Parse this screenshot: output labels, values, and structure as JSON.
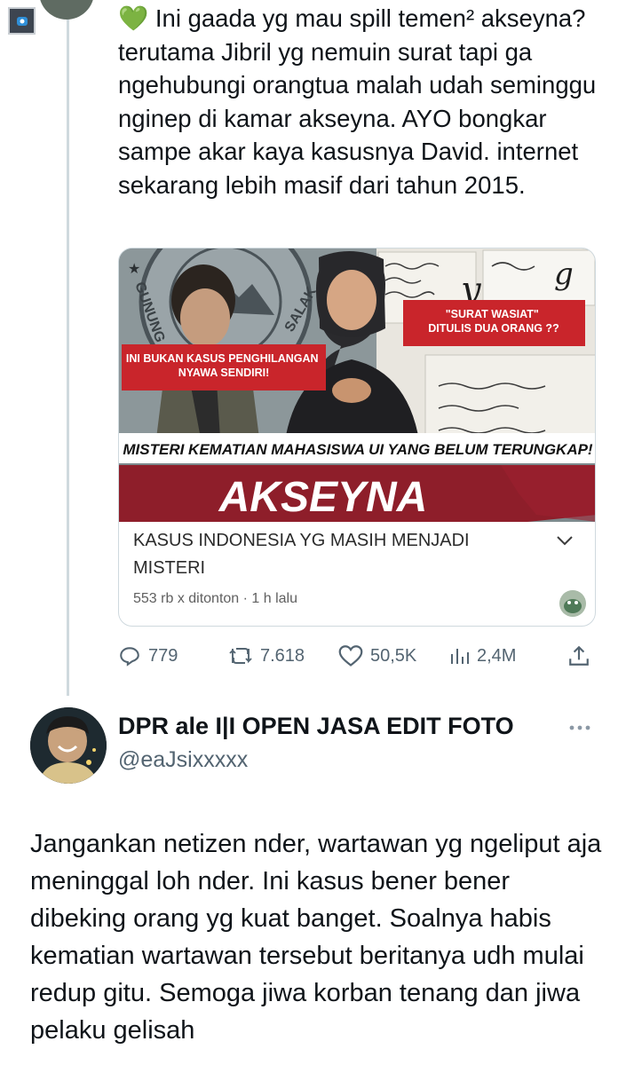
{
  "thread": {
    "text": "💚 Ini gaada yg mau spill temen² akseyna? terutama Jibril yg nemuin surat tapi ga ngehubungi orangtua malah udah seminggu  nginep di kamar akseyna. AYO bongkar sampe akar kaya kasusnya David. internet sekarang lebih masif dari tahun 2015."
  },
  "video_card": {
    "thumbnail": {
      "label_left": "INI BUKAN KASUS PENGHILANGAN NYAWA SENDIRI!",
      "label_right": "\"SURAT WASIAT\" DITULIS DUA ORANG ??",
      "headline": "MISTERI KEMATIAN MAHASISWA UI YANG BELUM TERUNGKAP!",
      "banner": "AKSEYNA",
      "emblem_text": "GUNUNG",
      "emblem_text_right": "SALAK",
      "colors": {
        "red": "#c9252b",
        "maroon": "#8e1e2a"
      }
    },
    "title": "KASUS INDONESIA YG MASIH MENJADI MISTERI",
    "meta": "553 rb x ditonton · 1 h lalu",
    "expand_icon": "chevron-down-icon"
  },
  "actions": {
    "replies": "779",
    "reposts": "7.618",
    "likes": "50,5K",
    "views": "2,4M"
  },
  "reply": {
    "author_name": "DPR ale I|I OPEN JASA EDIT FOTO",
    "handle": "@eaJsixxxxx",
    "text": "Jangankan netizen nder, wartawan yg ngeliput aja meninggal loh nder. Ini kasus bener bener dibeking orang yg kuat banget. Soalnya habis kematian wartawan tersebut beritanya udh mulai redup gitu. Semoga jiwa korban tenang dan jiwa pelaku gelisah"
  },
  "colors": {
    "text_primary": "#0f1419",
    "text_secondary": "#536471",
    "divider": "#cfd9de"
  }
}
